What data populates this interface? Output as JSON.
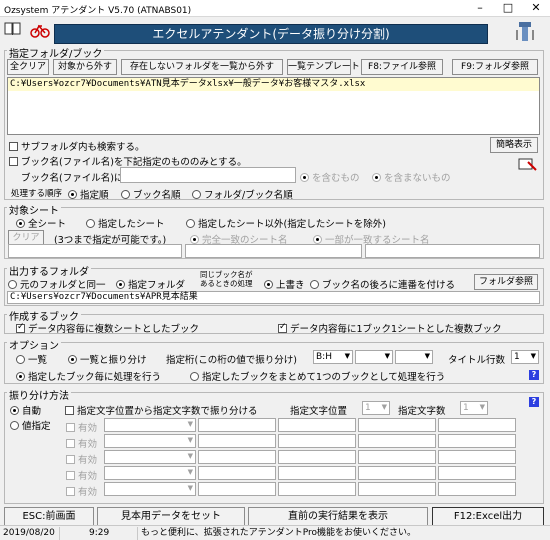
{
  "window": {
    "title": "Ozsystem アテンダント V5.70 (ATNABS01)",
    "minimize": "–",
    "maximize": "□",
    "close": "✕"
  },
  "banner": {
    "title": "エクセルアテンダント(データ振り分け分割)"
  },
  "folder_book": {
    "label": "指定フォルダ/ブック",
    "buttons": {
      "clear_all": "全クリア",
      "remove_target": "対象から外す",
      "remove_missing": "存在しないフォルダを一覧から外す",
      "template": "一覧テンプレート",
      "f8": "F8:ファイル参照",
      "f9": "F9:フォルダ参照"
    },
    "path": "C:¥Users¥ozcr7¥Documents¥ATN見本データxlsx¥一般データ¥お客様マスタ.xlsx",
    "include_subfolders": "サブフォルダ内も検索する。",
    "simple_display": "簡略表示",
    "book_name_filter": "ブック名(ファイル名)を下記指定のもののみとする。",
    "book_name_label": "ブック名(ファイル名)に",
    "contains": "を含むもの",
    "not_contains": "を含まないもの",
    "order_label": "処理する順序",
    "order_specified": "指定順",
    "order_book": "ブック名順",
    "order_folder": "フォルダ/ブック名順"
  },
  "target_sheet": {
    "label": "対象シート",
    "all_sheets": "全シート",
    "specified_sheet": "指定したシート",
    "except_sheet": "指定したシート以外(指定したシートを除外)",
    "clear": "クリア",
    "note": "(3つまで指定が可能です。)",
    "exact_match": "完全一致のシート名",
    "partial_match": "一部が一致するシート名"
  },
  "output_folder": {
    "label": "出力するフォルダ",
    "same_as_source": "元のフォルダと同一",
    "specified_folder": "指定フォルダ",
    "same_name_note": "同じブック名が\nあるときの処理",
    "overwrite": "上書き",
    "append_serial": "ブック名の後ろに連番を付ける",
    "folder_ref": "フォルダ参照",
    "path": "C:¥Users¥ozcr7¥Documents¥APR見本結果"
  },
  "create_book": {
    "label": "作成するブック",
    "multi_sheet": "データ内容毎に複数シートとしたブック",
    "one_sheet": "データ内容毎に1ブック1シートとした複数ブック"
  },
  "options": {
    "label": "オプション",
    "list": "一覧",
    "list_and_split": "一覧と振り分け",
    "key_column_label": "指定桁(この桁の値で振り分け)",
    "key_column_value": "B:H",
    "title_rows_label": "タイトル行数",
    "title_rows_value": "1",
    "per_book": "指定したブック毎に処理を行う",
    "combine_books": "指定したブックをまとめて1つのブックとして処理を行う",
    "help": "?"
  },
  "method": {
    "label": "振り分け方法",
    "auto": "自動",
    "value_spec": "値指定",
    "fixed_pos": "指定文字位置から指定文字数で振り分ける",
    "char_pos_label": "指定文字位置",
    "char_pos_value": "1",
    "char_count_label": "指定文字数",
    "char_count_value": "1",
    "help": "?",
    "rows": [
      "有効",
      "有効",
      "有効",
      "有効",
      "有効"
    ]
  },
  "footer": {
    "esc": "ESC:前画面",
    "sample": "見本用データをセット",
    "last_result": "直前の実行結果を表示",
    "f12": "F12:Excel出力"
  },
  "status": {
    "date": "2019/08/20",
    "time": "9:29",
    "message": "もっと便利に、拡張されたアテンダントPro機能をお使いください。"
  },
  "colors": {
    "banner_bg": "#1e4e79",
    "help_blue": "#2d3fe0"
  }
}
